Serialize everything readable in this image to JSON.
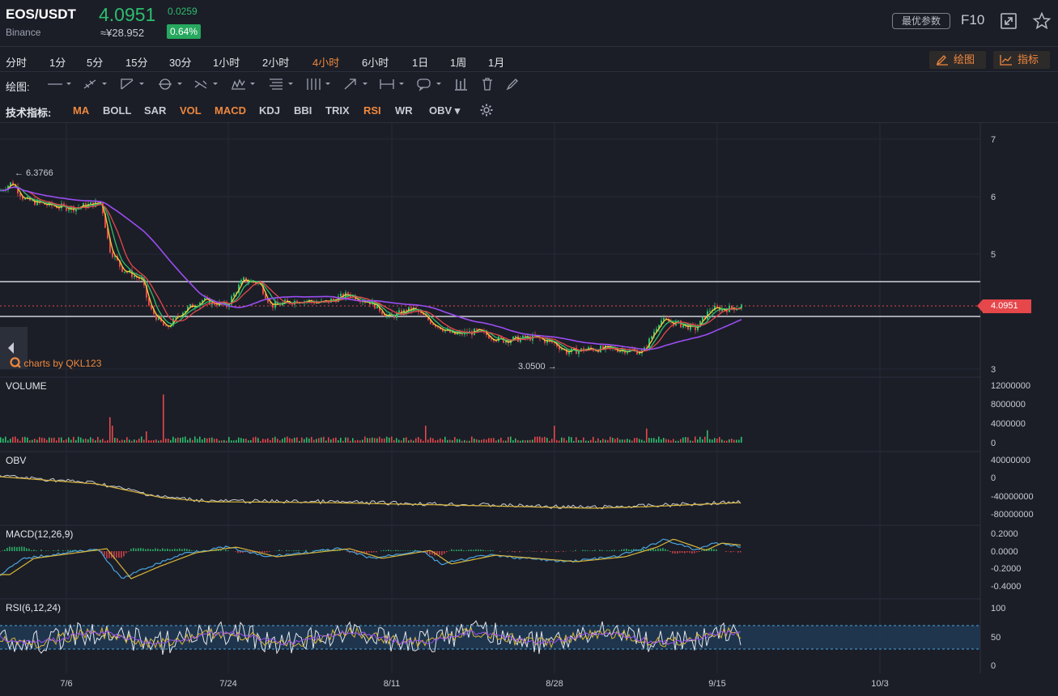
{
  "header": {
    "symbol": "EOS/USDT",
    "exchange": "Binance",
    "price": "4.0951",
    "cny_price": "≈¥28.952",
    "change": "0.0259",
    "change_pct": "0.64%",
    "optimize_label": "最优参数",
    "f10_label": "F10",
    "fullscreen_icon": "fullscreen-icon",
    "star_icon": "star-icon"
  },
  "timeframes": [
    "分时",
    "1分",
    "5分",
    "15分",
    "30分",
    "1小时",
    "2小时",
    "4小时",
    "6小时",
    "1日",
    "1周",
    "1月"
  ],
  "active_timeframe": "4小时",
  "right_buttons": {
    "draw": "绘图",
    "indicator": "指标"
  },
  "draw_tools": {
    "label": "绘图:"
  },
  "indicators": {
    "label": "技术指标:",
    "items": [
      {
        "name": "MA",
        "on": true
      },
      {
        "name": "BOLL",
        "on": false
      },
      {
        "name": "SAR",
        "on": false
      },
      {
        "name": "VOL",
        "on": true
      },
      {
        "name": "MACD",
        "on": true
      },
      {
        "name": "KDJ",
        "on": false
      },
      {
        "name": "BBI",
        "on": false
      },
      {
        "name": "TRIX",
        "on": false
      },
      {
        "name": "RSI",
        "on": true
      },
      {
        "name": "WR",
        "on": false
      },
      {
        "name": "OBV ▾",
        "on": false
      }
    ]
  },
  "main_chart": {
    "y_ticks": [
      "7",
      "6",
      "5",
      "3"
    ],
    "high_label": "← 6.3766",
    "low_label": "3.0500 →",
    "current_price_tag": "4.0951",
    "watermark": "charts by QKL123"
  },
  "panels": {
    "volume": {
      "label": "VOLUME",
      "ticks": [
        "12000000",
        "8000000",
        "4000000",
        "0"
      ]
    },
    "obv": {
      "label": "OBV",
      "ticks": [
        "40000000",
        "0",
        "-40000000",
        "-80000000"
      ]
    },
    "macd": {
      "label": "MACD(12,26,9)",
      "ticks": [
        "0.2000",
        "0.0000",
        "-0.2000",
        "-0.4000"
      ]
    },
    "rsi": {
      "label": "RSI(6,12,24)",
      "ticks": [
        "100",
        "50",
        "0"
      ]
    }
  },
  "x_ticks": [
    "7/6",
    "7/24",
    "8/11",
    "8/28",
    "9/15",
    "10/3"
  ],
  "colors": {
    "up": "#2ebd6e",
    "down": "#e5474b",
    "accent": "#f0883e",
    "ma_fast": "#f2d13a",
    "ma_mid": "#2ebd6e",
    "ma_slow": "#e5474b",
    "ma_long": "#9b4df2"
  }
}
